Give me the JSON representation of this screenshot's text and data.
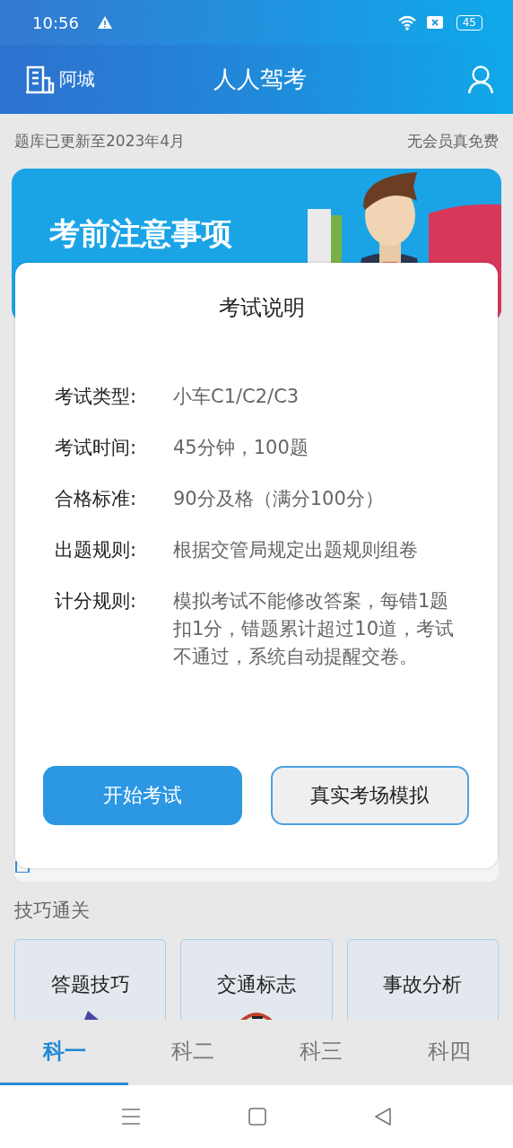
{
  "status_bar": {
    "time": "10:56",
    "battery": "45"
  },
  "header": {
    "city": "阿城",
    "title": "人人驾考"
  },
  "notice": {
    "left": "题库已更新至2023年4月",
    "right": "无会员真免费"
  },
  "banner": {
    "title": "考前注意事项"
  },
  "dialog": {
    "title": "考试说明",
    "rows": [
      {
        "label": "考试类型:",
        "value": "小车C1/C2/C3"
      },
      {
        "label": "考试时间:",
        "value": "45分钟，100题"
      },
      {
        "label": "合格标准:",
        "value": "90分及格（满分100分）"
      },
      {
        "label": "出题规则:",
        "value": "根据交管局规定出题规则组卷"
      },
      {
        "label": "计分规则:",
        "value": "模拟考试不能修改答案，每错1题扣1分，错题累计超过10道，考试不通过，系统自动提醒交卷。"
      }
    ],
    "buttons": [
      {
        "label": "开始考试",
        "kind": "primary"
      },
      {
        "label": "真实考场模拟",
        "kind": "secondary"
      }
    ]
  },
  "skills": {
    "title": "技巧通关",
    "cards": [
      {
        "label": "答题技巧"
      },
      {
        "label": "交通标志"
      },
      {
        "label": "事故分析"
      }
    ]
  },
  "tabs": [
    {
      "label": "科一",
      "selected": true
    },
    {
      "label": "科二",
      "selected": false
    },
    {
      "label": "科三",
      "selected": false
    },
    {
      "label": "科四",
      "selected": false
    }
  ]
}
